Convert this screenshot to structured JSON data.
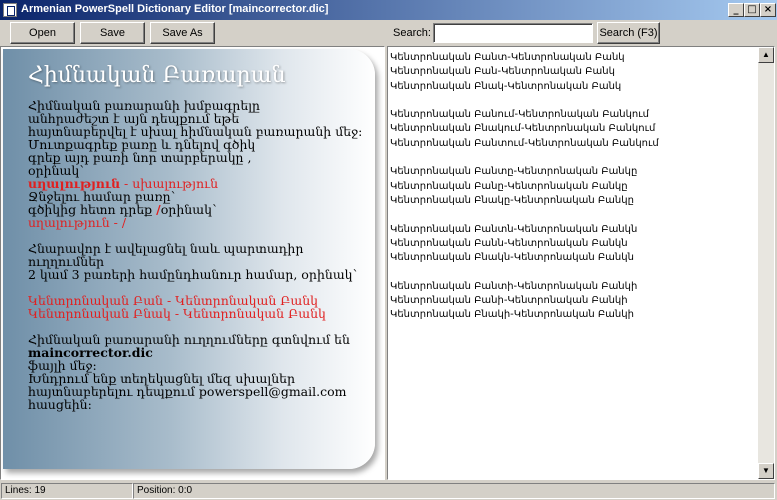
{
  "window": {
    "title": "Armenian PowerSpell Dictionary Editor [maincorrector.dic]",
    "min_glyph": "_",
    "max_glyph": "□",
    "close_glyph": "×"
  },
  "toolbar": {
    "open_label": "Open",
    "save_label": "Save",
    "saveas_label": "Save As",
    "search_label": "Search:",
    "search_value": "",
    "search_button_label": "Search (F3)"
  },
  "info": {
    "title": "Հիմնական Բառարան",
    "lines": [
      {
        "text": "Հիմնական բառարանի խմբագրելը",
        "style": "normal"
      },
      {
        "text": "անհրաժեշտ է այն դեպքում եթե",
        "style": "normal"
      },
      {
        "text": "հայտնաբերվել է սխալ հիմնական բառարանի մեջ:",
        "style": "normal"
      },
      {
        "text": "Մուտքագրեք բառը և դնելով գծիկ",
        "style": "normal"
      },
      {
        "text": "գրեք այդ բառի նոր տարբերակը ,",
        "style": "normal"
      },
      {
        "text": "օրինակ`",
        "style": "normal"
      },
      {
        "text": "",
        "style": "mixed",
        "parts": [
          {
            "text": "սղալություն",
            "style": "red-bold"
          },
          {
            "text": " - սխալություն",
            "style": "red"
          }
        ]
      },
      {
        "text": "Ջնջելու համար բառը`",
        "style": "normal"
      },
      {
        "text": "",
        "style": "mixed",
        "parts": [
          {
            "text": "գծիկից հետո դրեք ",
            "style": "normal"
          },
          {
            "text": "/",
            "style": "red-bold"
          },
          {
            "text": "օրինակ`",
            "style": "normal"
          }
        ]
      },
      {
        "text": "սղալություն - /",
        "style": "red"
      },
      {
        "text": "",
        "style": "blank"
      },
      {
        "text": "Հնարավոր է ավելացնել նաև պարտադիր ուղղումներ",
        "style": "normal"
      },
      {
        "text": "2 կամ 3 բառերի համընդհանուր համար, օրինակ`",
        "style": "normal"
      },
      {
        "text": "",
        "style": "blank"
      },
      {
        "text": "Կենտրոնական Բան - Կենտրոնական Բանկ",
        "style": "red"
      },
      {
        "text": "Կենտրոնական Բնակ - Կենտրոնական Բանկ",
        "style": "red"
      },
      {
        "text": "",
        "style": "blank"
      },
      {
        "text": "Հիմնական բառարանի ուղղումները գտնվում են",
        "style": "normal"
      },
      {
        "text": "maincorrector.dic",
        "style": "bold"
      },
      {
        "text": "ֆայլի մեջ:",
        "style": "normal"
      },
      {
        "text": "Խնդրում ենք տեղեկացնել մեզ սխալներ",
        "style": "normal"
      },
      {
        "text": "հայտնաբերելու դեպքում powerspell@gmail.com",
        "style": "normal"
      },
      {
        "text": "հասցեին:",
        "style": "normal"
      }
    ]
  },
  "editor_lines": [
    "Կենտրոնական Բանտ-Կենտրոնական Բանկ",
    "Կենտրոնական Բան-Կենտրոնական Բանկ",
    "Կենտրոնական Բնակ-Կենտրոնական Բանկ",
    "",
    "Կենտրոնական Բանում-Կենտրոնական Բանկում",
    "Կենտրոնական Բնակում-Կենտրոնական Բանկում",
    "Կենտրոնական Բանտում-Կենտրոնական Բանկում",
    "",
    "Կենտրոնական Բանտը-Կենտրոնական Բանկը",
    "Կենտրոնական Բանը-Կենտրոնական Բանկը",
    "Կենտրոնական Բնակը-Կենտրոնական Բանկը",
    "",
    "Կենտրոնական Բանտն-Կենտրոնական Բանկն",
    "Կենտրոնական Բանն-Կենտրոնական Բանկն",
    "Կենտրոնական Բնակն-Կենտրոնական Բանկն",
    "",
    "Կենտրոնական Բանտի-Կենտրոնական Բանկի",
    "Կենտրոնական Բանի-Կենտրոնական Բանկի",
    "Կենտրոնական Բնակի-Կենտրոնական Բանկի"
  ],
  "scrollbar": {
    "up_glyph": "▲",
    "down_glyph": "▼"
  },
  "status": {
    "lines": "Lines: 19",
    "position": "Position: 0:0"
  }
}
